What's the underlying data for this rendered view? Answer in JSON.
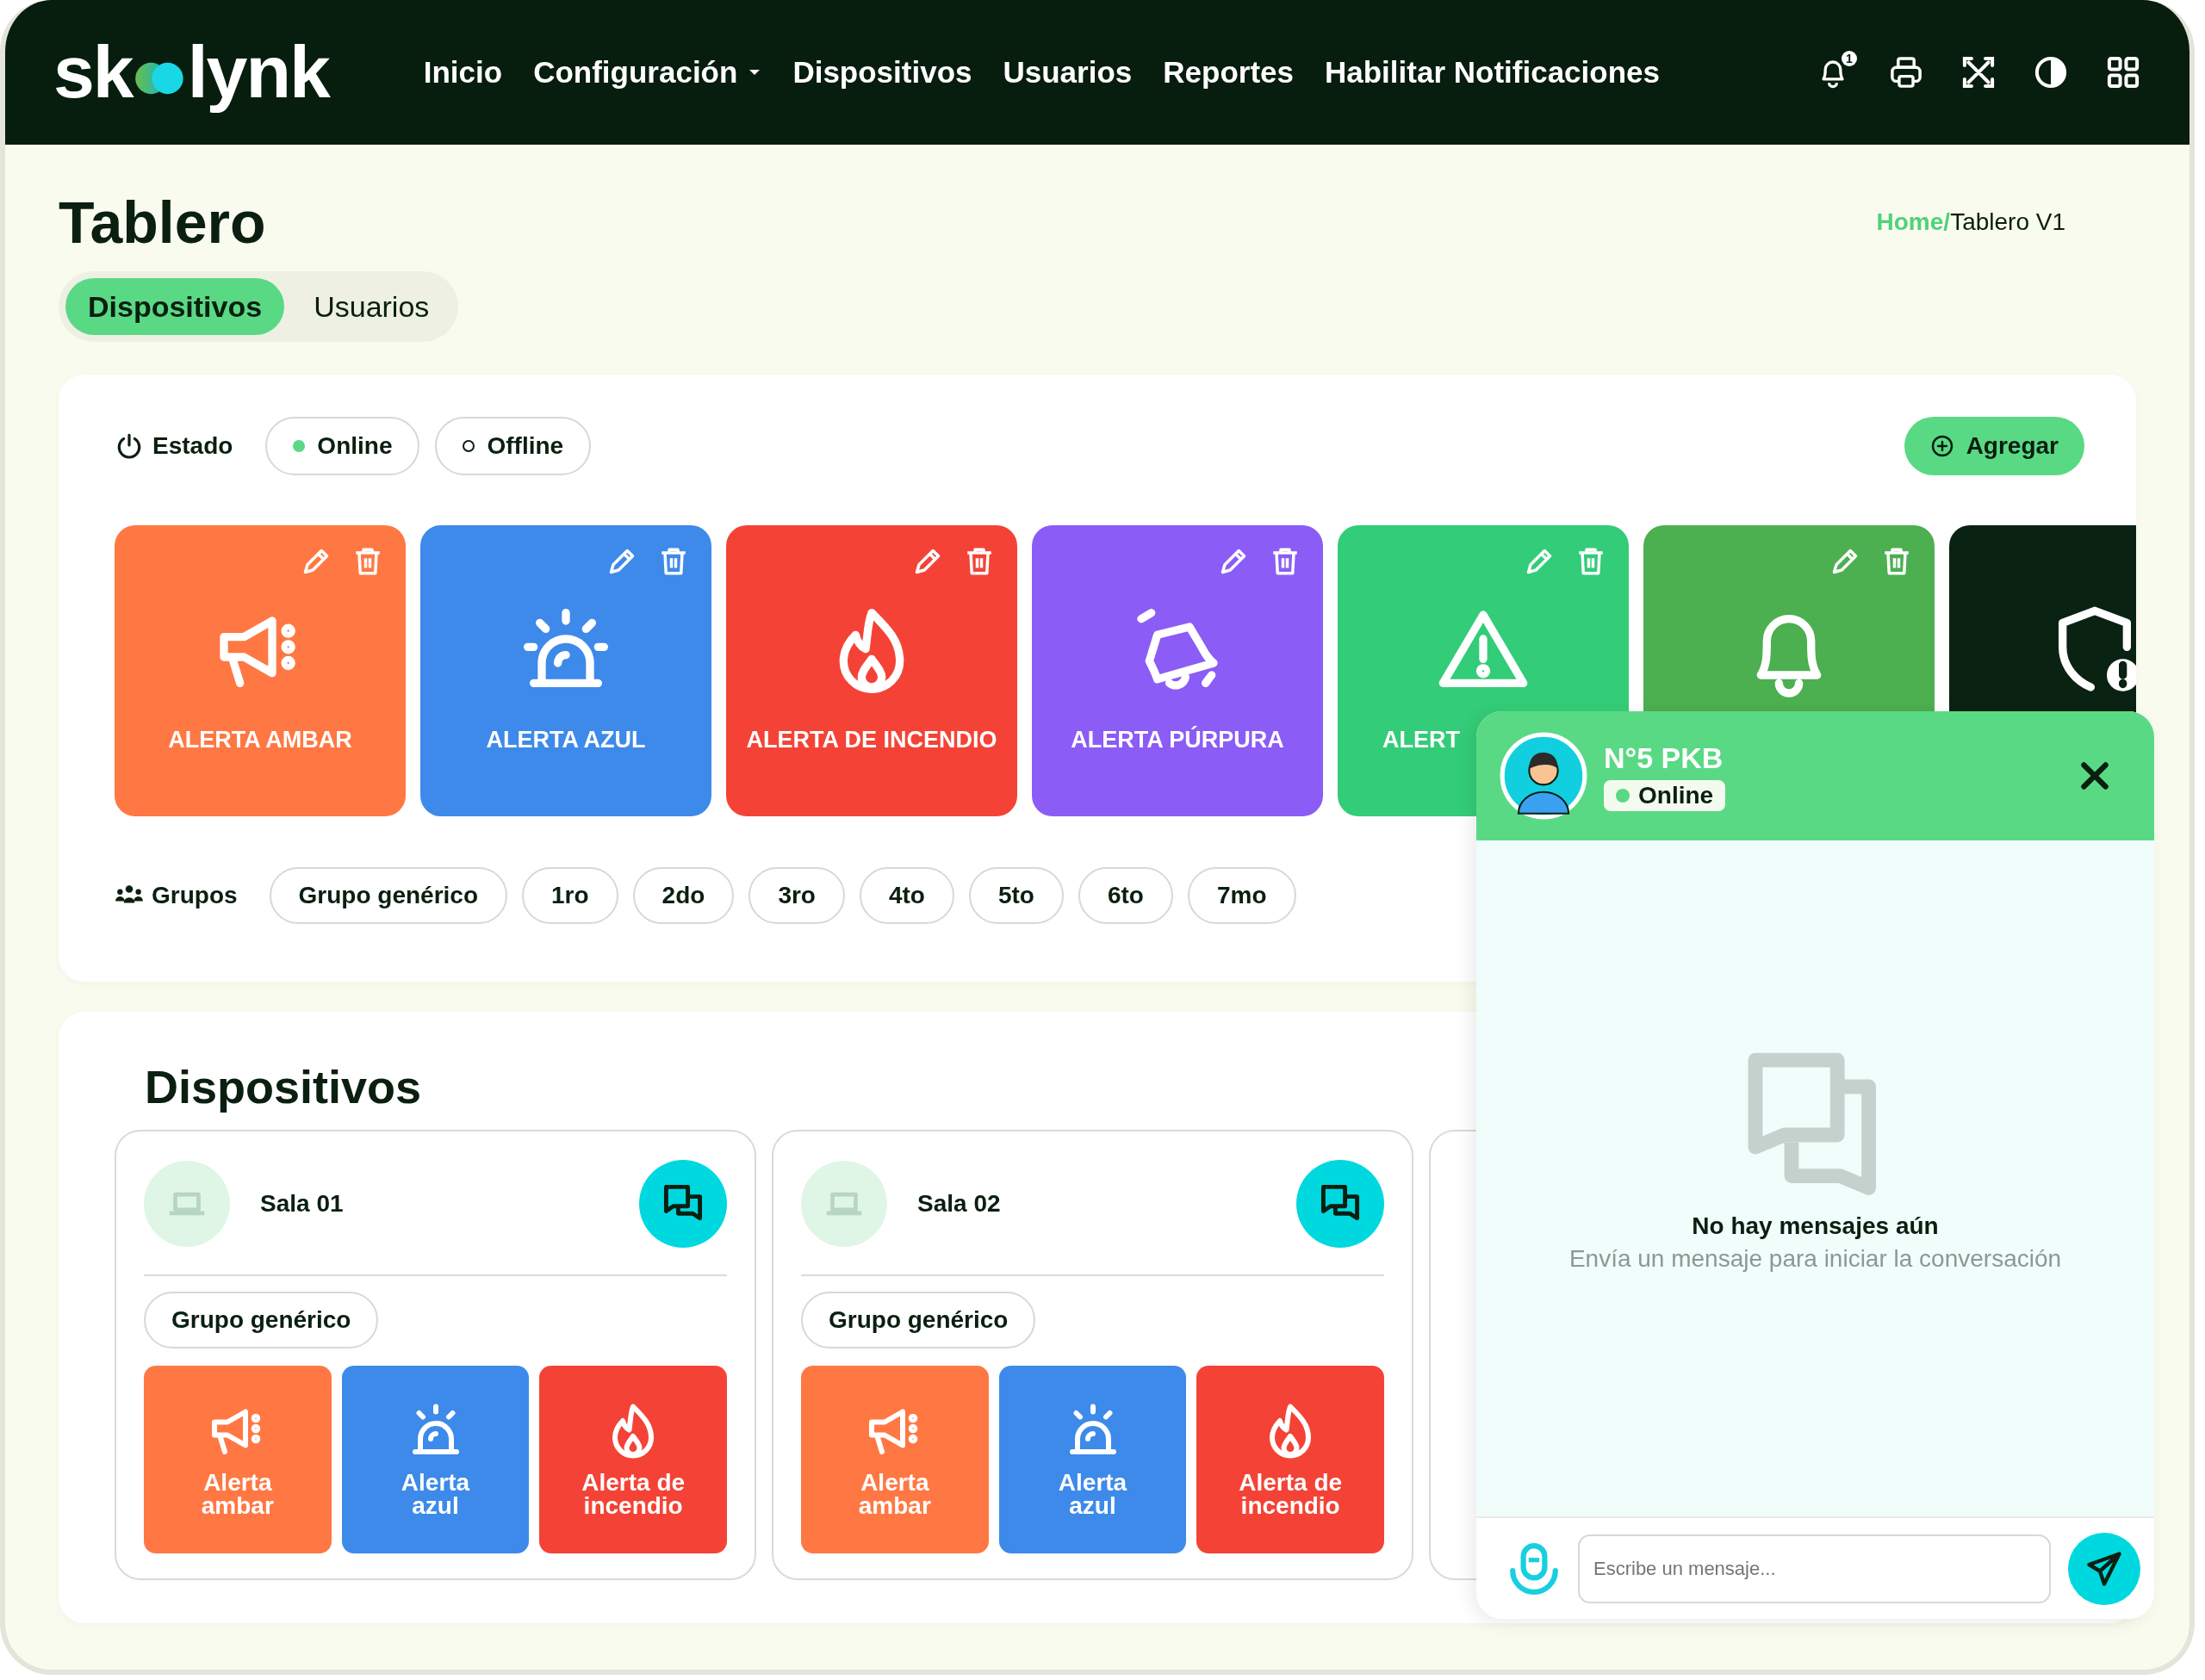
{
  "header": {
    "logo_start": "sk",
    "logo_end": "lynk",
    "notification_count": "1",
    "nav": [
      {
        "label": "Inicio",
        "dropdown": false
      },
      {
        "label": "Configuración",
        "dropdown": true
      },
      {
        "label": "Dispositivos",
        "dropdown": false
      },
      {
        "label": "Usuarios",
        "dropdown": false
      },
      {
        "label": "Reportes",
        "dropdown": false
      },
      {
        "label": "Habilitar Notificaciones",
        "dropdown": false
      }
    ]
  },
  "page": {
    "title": "Tablero",
    "breadcrumb": {
      "home": "Home/",
      "current": "Tablero V1"
    }
  },
  "tabs": [
    {
      "label": "Dispositivos",
      "selected": true
    },
    {
      "label": "Usuarios",
      "selected": false
    }
  ],
  "status_filter": {
    "label": "Estado",
    "options": [
      {
        "label": "Online",
        "kind": "online"
      },
      {
        "label": "Offline",
        "kind": "offline"
      }
    ]
  },
  "add_button": "Agregar",
  "alerts": [
    {
      "label": "ALERTA AMBAR",
      "color": "#ff7843",
      "kind": "megaphone",
      "label_cut": false
    },
    {
      "label": "ALERTA AZUL",
      "color": "#3d8aea",
      "kind": "siren",
      "label_cut": false
    },
    {
      "label": "ALERTA DE INCENDIO",
      "color": "#f44336",
      "kind": "flame",
      "label_cut": false
    },
    {
      "label": "ALERTA PÚRPURA",
      "color": "#8b5cf6",
      "kind": "bell-ring",
      "label_cut": false
    },
    {
      "label": "ALERT",
      "color": "#33cc78",
      "kind": "warning",
      "label_cut": true
    },
    {
      "color": "#4caf50",
      "kind": "bell"
    },
    {
      "color": "#0a2212",
      "kind": "shield"
    }
  ],
  "groups": {
    "label": "Grupos",
    "items": [
      "Grupo genérico",
      "1ro",
      "2do",
      "3ro",
      "4to",
      "5to",
      "6to",
      "7mo"
    ]
  },
  "devices": {
    "title": "Dispositivos",
    "more_cut_off": true,
    "items": [
      {
        "name": "Sala 01",
        "group": "Grupo genérico",
        "alerts": [
          {
            "label": "Alerta ambar",
            "color": "#ff7843",
            "kind": "megaphone"
          },
          {
            "label": "Alerta azul",
            "color": "#3d8aea",
            "kind": "siren"
          },
          {
            "label": "Alerta de incendio",
            "color": "#f44336",
            "kind": "flame"
          }
        ]
      },
      {
        "name": "Sala 02",
        "group": "Grupo genérico",
        "alerts": [
          {
            "label": "Alerta ambar",
            "color": "#ff7843",
            "kind": "megaphone"
          },
          {
            "label": "Alerta azul",
            "color": "#3d8aea",
            "kind": "siren"
          },
          {
            "label": "Alerta de incendio",
            "color": "#f44336",
            "kind": "flame"
          }
        ]
      }
    ]
  },
  "chat": {
    "name": "N°5 PKB",
    "status": "Online",
    "online": true,
    "empty_title": "No hay mensajes aún",
    "empty_text": "Envía un mensaje para iniciar la conversación",
    "placeholder": "Escribe un mensaje..."
  }
}
